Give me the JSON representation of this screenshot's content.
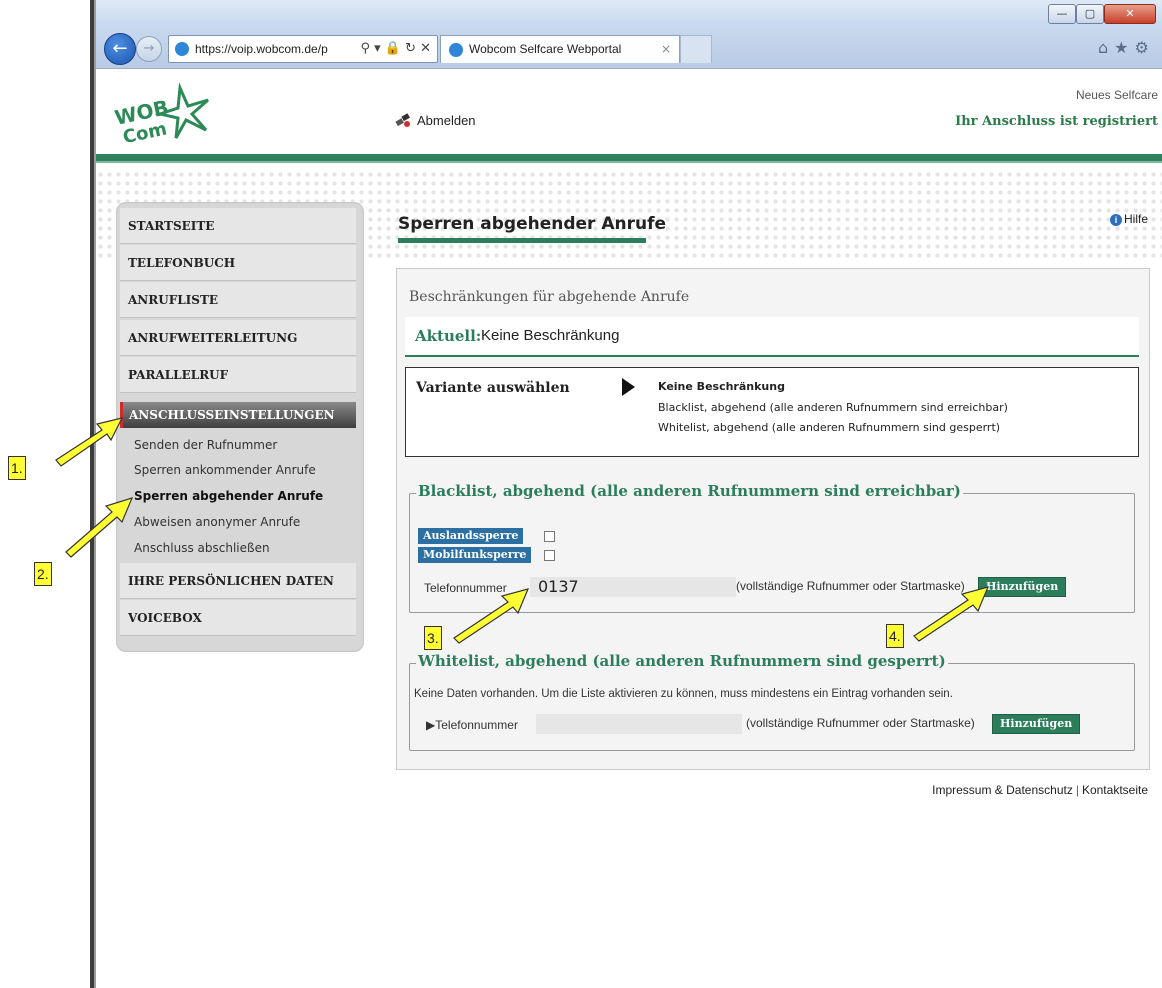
{
  "browser": {
    "url": "https://voip.wobcom.de/p",
    "tab_title": "Wobcom Selfcare Webportal",
    "tab_close": "×",
    "addr_tools": "⚲ ▾ 🔒 ↻ ✕",
    "win_min": "—",
    "win_max": "▢",
    "win_close": "✕",
    "toolbar_icons": "⌂★⚙"
  },
  "header": {
    "logout_label": "Abmelden",
    "neues_selfcare": "Neues Selfcare",
    "status": "Ihr Anschluss ist registriert"
  },
  "sidebar": {
    "items": [
      {
        "label": "STARTSEITE"
      },
      {
        "label": "TELEFONBUCH"
      },
      {
        "label": "ANRUFLISTE"
      },
      {
        "label": "ANRUFWEITERLEITUNG"
      },
      {
        "label": "PARALLELRUF"
      }
    ],
    "active": "ANSCHLUSSEINSTELLUNGEN",
    "subitems": [
      {
        "label": "Senden der Rufnummer"
      },
      {
        "label": "Sperren ankommender Anrufe"
      },
      {
        "label": "Sperren abgehender Anrufe"
      },
      {
        "label": "Abweisen anonymer Anrufe"
      },
      {
        "label": "Anschluss abschließen"
      }
    ],
    "items_bottom": [
      {
        "label": "IHRE PERSÖNLICHEN DATEN"
      },
      {
        "label": "VOICEBOX"
      }
    ]
  },
  "main": {
    "title": "Sperren abgehender Anrufe",
    "help": "Hilfe",
    "restrictions_title": "Beschränkungen für abgehende Anrufe",
    "aktuell_label": "Aktuell:",
    "aktuell_value": "Keine Beschränkung",
    "variante_label": "Variante auswählen",
    "variante_options": [
      "Keine Beschränkung",
      "Blacklist, abgehend (alle anderen Rufnummern sind erreichbar)",
      "Whitelist, abgehend (alle anderen Rufnummern sind gesperrt)"
    ],
    "blacklist": {
      "legend": "Blacklist, abgehend (alle anderen Rufnummern sind erreichbar)",
      "auslandssperre": "Auslandssperre",
      "mobilfunksperre": "Mobilfunksperre",
      "phone_label": "Telefonnummer",
      "phone_value": "0137",
      "hint": "(vollständige Rufnummer oder Startmaske)",
      "add_button": "Hinzufügen"
    },
    "whitelist": {
      "legend": "Whitelist, abgehend (alle anderen Rufnummern sind gesperrt)",
      "no_data": "Keine Daten vorhanden. Um die Liste aktivieren zu können, muss mindestens ein Eintrag vorhanden sein.",
      "phone_label": "▶Telefonnummer",
      "phone_value": "",
      "hint": "(vollständige Rufnummer oder Startmaske)",
      "add_button": "Hinzufügen"
    }
  },
  "footer": {
    "impressum": "Impressum & Datenschutz",
    "separator": "|",
    "kontakt": "Kontaktseite"
  },
  "annotations": {
    "c1": "1.",
    "c2": "2.",
    "c3": "3.",
    "c4": "4."
  },
  "colors": {
    "brand_green": "#2b7d5c",
    "badge_blue": "#2b6fa3",
    "callout_yellow": "#ffff33"
  }
}
